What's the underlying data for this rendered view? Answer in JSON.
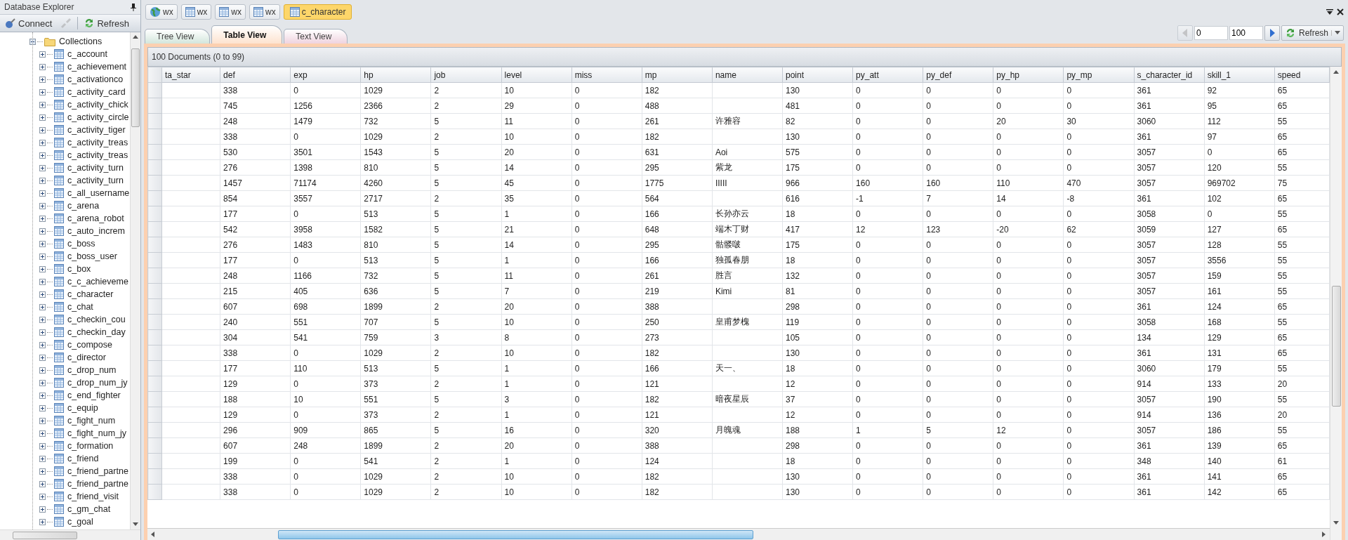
{
  "sidebar": {
    "title": "Database Explorer",
    "toolbar": [
      {
        "kind": "connect",
        "label": "Connect",
        "disabled": false
      },
      {
        "kind": "disconnect",
        "disabled": true
      },
      {
        "kind": "refresh",
        "label": "Refresh",
        "disabled": false
      }
    ],
    "tree": [
      {
        "label": "Collections",
        "expanded": true,
        "children": [
          {
            "label": "c_account",
            "expanded": false
          },
          {
            "label": "c_achievement",
            "expanded": false
          },
          {
            "label": "c_activationco",
            "expanded": false
          },
          {
            "label": "c_activity_card",
            "expanded": false
          },
          {
            "label": "c_activity_chick",
            "expanded": false
          },
          {
            "label": "c_activity_circle",
            "expanded": false
          },
          {
            "label": "c_activity_tiger",
            "expanded": false
          },
          {
            "label": "c_activity_treas",
            "expanded": false
          },
          {
            "label": "c_activity_treas",
            "expanded": false
          },
          {
            "label": "c_activity_turn",
            "expanded": false
          },
          {
            "label": "c_activity_turn",
            "expanded": false
          },
          {
            "label": "c_all_username",
            "expanded": false
          },
          {
            "label": "c_arena",
            "expanded": false
          },
          {
            "label": "c_arena_robot",
            "expanded": false
          },
          {
            "label": "c_auto_increm",
            "expanded": false
          },
          {
            "label": "c_boss",
            "expanded": false
          },
          {
            "label": "c_boss_user",
            "expanded": false
          },
          {
            "label": "c_box",
            "expanded": false
          },
          {
            "label": "c_c_achieveme",
            "expanded": false
          },
          {
            "label": "c_character",
            "expanded": false
          },
          {
            "label": "c_chat",
            "expanded": false
          },
          {
            "label": "c_checkin_cou",
            "expanded": false
          },
          {
            "label": "c_checkin_day",
            "expanded": false
          },
          {
            "label": "c_compose",
            "expanded": false
          },
          {
            "label": "c_director",
            "expanded": false
          },
          {
            "label": "c_drop_num",
            "expanded": false
          },
          {
            "label": "c_drop_num_jy",
            "expanded": false
          },
          {
            "label": "c_end_fighter",
            "expanded": false
          },
          {
            "label": "c_equip",
            "expanded": false
          },
          {
            "label": "c_fight_num",
            "expanded": false
          },
          {
            "label": "c_fight_num_jy",
            "expanded": false
          },
          {
            "label": "c_formation",
            "expanded": false
          },
          {
            "label": "c_friend",
            "expanded": false
          },
          {
            "label": "c_friend_partne",
            "expanded": false
          },
          {
            "label": "c_friend_partne",
            "expanded": false
          },
          {
            "label": "c_friend_visit",
            "expanded": false
          },
          {
            "label": "c_gm_chat",
            "expanded": false
          },
          {
            "label": "c_goal",
            "expanded": false
          }
        ]
      }
    ]
  },
  "doc_tabs": [
    {
      "kind": "server",
      "label": "wx",
      "selected": false
    },
    {
      "kind": "database",
      "label": "wx",
      "selected": false
    },
    {
      "kind": "database",
      "label": "wx",
      "selected": false
    },
    {
      "kind": "database",
      "label": "wx",
      "selected": false
    },
    {
      "kind": "collection",
      "label": "c_character",
      "selected": true
    }
  ],
  "view_tabs": [
    {
      "label": "Tree View",
      "selected": false,
      "color": "#d3e6dc"
    },
    {
      "label": "Table View",
      "selected": true,
      "color": "#fde3cf"
    },
    {
      "label": "Text View",
      "selected": false,
      "color": "#efd3df"
    }
  ],
  "pager": {
    "prev_disabled": true,
    "skip": "0",
    "limit": "100",
    "next_disabled": false,
    "refresh": "Refresh"
  },
  "table": {
    "summary": "100 Documents (0 to 99)",
    "columns": [
      "ta_star",
      "def",
      "exp",
      "hp",
      "job",
      "level",
      "miss",
      "mp",
      "name",
      "point",
      "py_att",
      "py_def",
      "py_hp",
      "py_mp",
      "s_character_id",
      "skill_1",
      "speed"
    ],
    "rows": [
      [
        null,
        "338",
        "0",
        "1029",
        "2",
        "10",
        "0",
        "182",
        null,
        "130",
        "0",
        "0",
        "0",
        "0",
        "361",
        "92",
        "65"
      ],
      [
        null,
        "745",
        "1256",
        "2366",
        "2",
        "29",
        "0",
        "488",
        null,
        "481",
        "0",
        "0",
        "0",
        "0",
        "361",
        "95",
        "65"
      ],
      [
        null,
        "248",
        "1479",
        "732",
        "5",
        "11",
        "0",
        "261",
        "许雅容",
        "82",
        "0",
        "0",
        "20",
        "30",
        "3060",
        "112",
        "55"
      ],
      [
        null,
        "338",
        "0",
        "1029",
        "2",
        "10",
        "0",
        "182",
        null,
        "130",
        "0",
        "0",
        "0",
        "0",
        "361",
        "97",
        "65"
      ],
      [
        null,
        "530",
        "3501",
        "1543",
        "5",
        "20",
        "0",
        "631",
        "Aoi",
        "575",
        "0",
        "0",
        "0",
        "0",
        "3057",
        "0",
        "65"
      ],
      [
        null,
        "276",
        "1398",
        "810",
        "5",
        "14",
        "0",
        "295",
        "紫龙",
        "175",
        "0",
        "0",
        "0",
        "0",
        "3057",
        "120",
        "55"
      ],
      [
        null,
        "1457",
        "71174",
        "4260",
        "5",
        "45",
        "0",
        "1775",
        "IIIII",
        "966",
        "160",
        "160",
        "110",
        "470",
        "3057",
        "969702",
        "75"
      ],
      [
        null,
        "854",
        "3557",
        "2717",
        "2",
        "35",
        "0",
        "564",
        null,
        "616",
        "-1",
        "7",
        "14",
        "-8",
        "361",
        "102",
        "65"
      ],
      [
        null,
        "177",
        "0",
        "513",
        "5",
        "1",
        "0",
        "166",
        "长孙亦云",
        "18",
        "0",
        "0",
        "0",
        "0",
        "3058",
        "0",
        "55"
      ],
      [
        null,
        "542",
        "3958",
        "1582",
        "5",
        "21",
        "0",
        "648",
        "端木丁财",
        "417",
        "12",
        "123",
        "-20",
        "62",
        "3059",
        "127",
        "65"
      ],
      [
        null,
        "276",
        "1483",
        "810",
        "5",
        "14",
        "0",
        "295",
        "骷髅啵",
        "175",
        "0",
        "0",
        "0",
        "0",
        "3057",
        "128",
        "55"
      ],
      [
        null,
        "177",
        "0",
        "513",
        "5",
        "1",
        "0",
        "166",
        "独孤春朋",
        "18",
        "0",
        "0",
        "0",
        "0",
        "3057",
        "3556",
        "55"
      ],
      [
        null,
        "248",
        "1166",
        "732",
        "5",
        "11",
        "0",
        "261",
        "胜言",
        "132",
        "0",
        "0",
        "0",
        "0",
        "3057",
        "159",
        "55"
      ],
      [
        null,
        "215",
        "405",
        "636",
        "5",
        "7",
        "0",
        "219",
        "Kimi",
        "81",
        "0",
        "0",
        "0",
        "0",
        "3057",
        "161",
        "55"
      ],
      [
        null,
        "607",
        "698",
        "1899",
        "2",
        "20",
        "0",
        "388",
        null,
        "298",
        "0",
        "0",
        "0",
        "0",
        "361",
        "124",
        "65"
      ],
      [
        null,
        "240",
        "551",
        "707",
        "5",
        "10",
        "0",
        "250",
        "皇甫梦槐",
        "119",
        "0",
        "0",
        "0",
        "0",
        "3058",
        "168",
        "55"
      ],
      [
        null,
        "304",
        "541",
        "759",
        "3",
        "8",
        "0",
        "273",
        null,
        "105",
        "0",
        "0",
        "0",
        "0",
        "134",
        "129",
        "65"
      ],
      [
        null,
        "338",
        "0",
        "1029",
        "2",
        "10",
        "0",
        "182",
        null,
        "130",
        "0",
        "0",
        "0",
        "0",
        "361",
        "131",
        "65"
      ],
      [
        null,
        "177",
        "110",
        "513",
        "5",
        "1",
        "0",
        "166",
        "天一、",
        "18",
        "0",
        "0",
        "0",
        "0",
        "3060",
        "179",
        "55"
      ],
      [
        null,
        "129",
        "0",
        "373",
        "2",
        "1",
        "0",
        "121",
        null,
        "12",
        "0",
        "0",
        "0",
        "0",
        "914",
        "133",
        "20"
      ],
      [
        null,
        "188",
        "10",
        "551",
        "5",
        "3",
        "0",
        "182",
        "暗夜星辰",
        "37",
        "0",
        "0",
        "0",
        "0",
        "3057",
        "190",
        "55"
      ],
      [
        null,
        "129",
        "0",
        "373",
        "2",
        "1",
        "0",
        "121",
        null,
        "12",
        "0",
        "0",
        "0",
        "0",
        "914",
        "136",
        "20"
      ],
      [
        null,
        "296",
        "909",
        "865",
        "5",
        "16",
        "0",
        "320",
        "月魄魂",
        "188",
        "1",
        "5",
        "12",
        "0",
        "3057",
        "186",
        "55"
      ],
      [
        null,
        "607",
        "248",
        "1899",
        "2",
        "20",
        "0",
        "388",
        null,
        "298",
        "0",
        "0",
        "0",
        "0",
        "361",
        "139",
        "65"
      ],
      [
        null,
        "199",
        "0",
        "541",
        "2",
        "1",
        "0",
        "124",
        null,
        "18",
        "0",
        "0",
        "0",
        "0",
        "348",
        "140",
        "61"
      ],
      [
        null,
        "338",
        "0",
        "1029",
        "2",
        "10",
        "0",
        "182",
        null,
        "130",
        "0",
        "0",
        "0",
        "0",
        "361",
        "141",
        "65"
      ],
      [
        null,
        "338",
        "0",
        "1029",
        "2",
        "10",
        "0",
        "182",
        null,
        "130",
        "0",
        "0",
        "0",
        "0",
        "361",
        "142",
        "65"
      ]
    ]
  }
}
